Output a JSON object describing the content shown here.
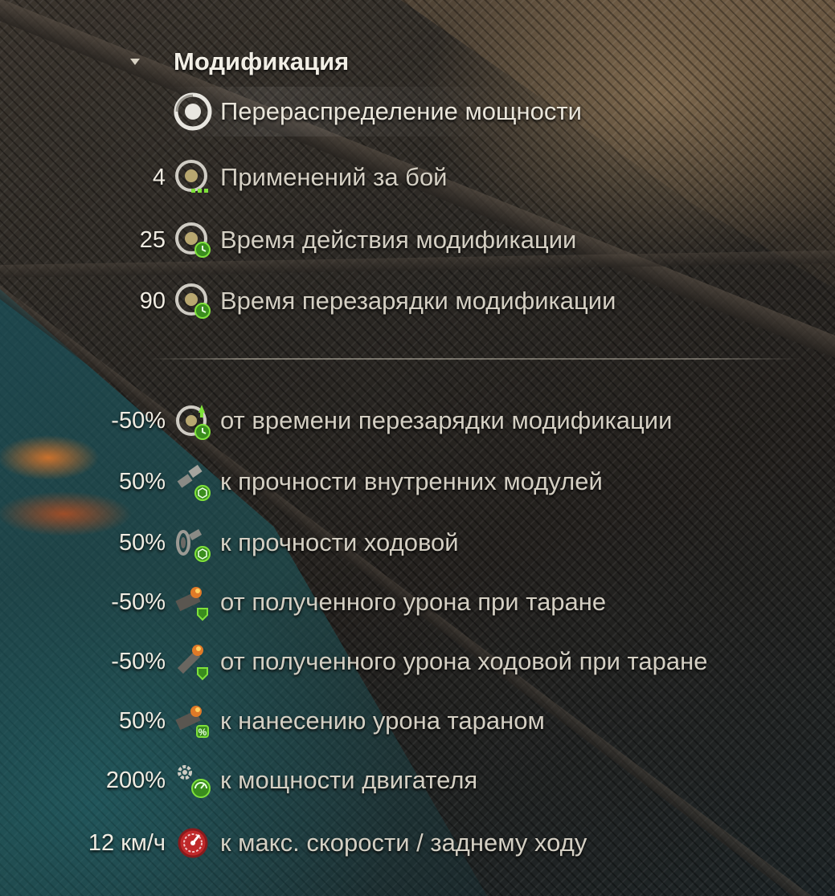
{
  "section": {
    "title": "Модификация"
  },
  "modification": {
    "name": "Перераспределение мощности",
    "icon": "power-redistribution-icon"
  },
  "stats": [
    {
      "value": "4",
      "label": "Применений за бой",
      "icon": "uses-per-battle-icon"
    },
    {
      "value": "25",
      "label": "Время действия модификации",
      "icon": "duration-timer-icon"
    },
    {
      "value": "90",
      "label": "Время перезарядки модификации",
      "icon": "cooldown-timer-icon"
    }
  ],
  "effects": [
    {
      "value": "-50%",
      "label": "от времени перезарядки модификации",
      "icon": "cooldown-reduction-icon"
    },
    {
      "value": "50%",
      "label": "к прочности внутренних модулей",
      "icon": "module-durability-icon"
    },
    {
      "value": "50%",
      "label": "к прочности ходовой",
      "icon": "suspension-durability-icon"
    },
    {
      "value": "-50%",
      "label": "от полученного урона при таране",
      "icon": "ram-damage-taken-icon"
    },
    {
      "value": "-50%",
      "label": "от полученного урона ходовой при таране",
      "icon": "suspension-ram-damage-icon"
    },
    {
      "value": "50%",
      "label": "к нанесению урона тараном",
      "icon": "ram-damage-dealt-icon"
    },
    {
      "value": "200%",
      "label": "к мощности двигателя",
      "icon": "engine-power-icon"
    },
    {
      "value": "12 км/ч",
      "label": "к макс. скорости / заднему ходу",
      "icon": "max-speed-icon"
    }
  ],
  "colors": {
    "accent_green": "#7fe23a",
    "speed_red": "#c0282a",
    "text": "#d4cfc3"
  }
}
